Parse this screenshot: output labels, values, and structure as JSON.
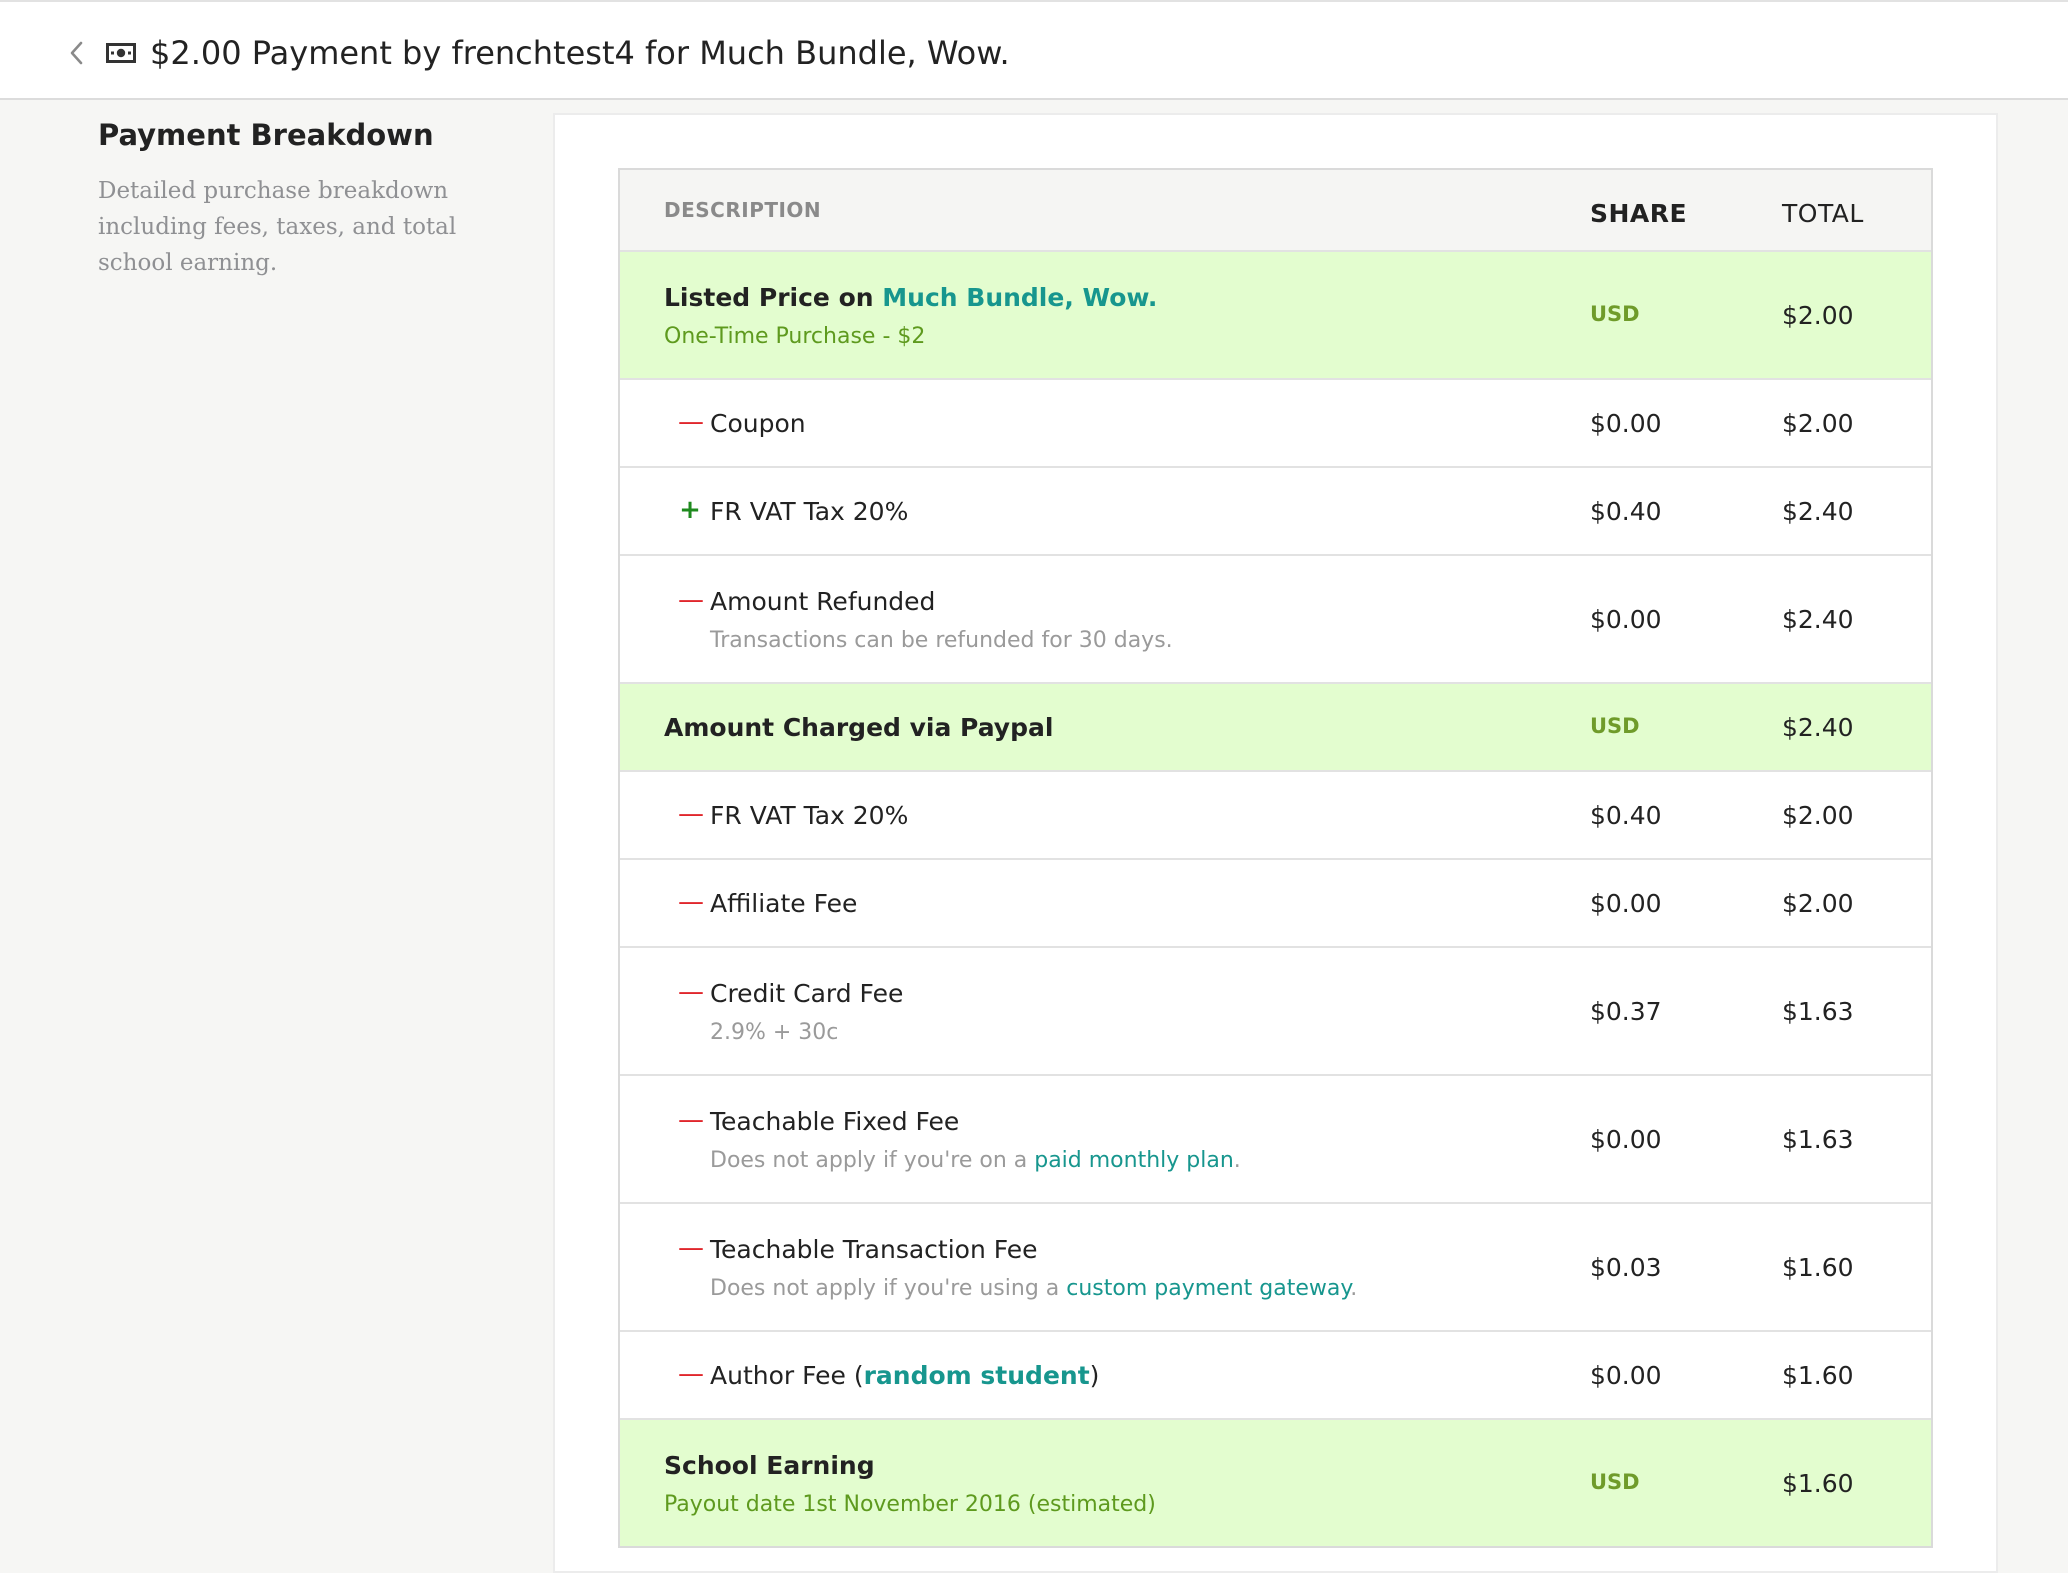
{
  "header": {
    "title": "$2.00 Payment by frenchtest4 for Much Bundle, Wow."
  },
  "sidebar": {
    "title": "Payment Breakdown",
    "description": "Detailed purchase breakdown including fees, taxes, and total school earning."
  },
  "table": {
    "columns": {
      "description": "DESCRIPTION",
      "share": "SHARE",
      "total": "TOTAL"
    },
    "listed": {
      "label_prefix": "Listed Price on ",
      "product": "Much Bundle, Wow.",
      "sub": "One-Time Purchase - $2",
      "share": "USD",
      "total": "$2.00"
    },
    "coupon": {
      "sign": "—",
      "label": "Coupon",
      "share": "$0.00",
      "total": "$2.00"
    },
    "vat_add": {
      "sign": "+",
      "label": "FR VAT Tax 20%",
      "share": "$0.40",
      "total": "$2.40"
    },
    "refund": {
      "sign": "—",
      "label": "Amount Refunded",
      "sub": "Transactions can be refunded for 30 days.",
      "share": "$0.00",
      "total": "$2.40"
    },
    "charged": {
      "label": "Amount Charged via Paypal",
      "share": "USD",
      "total": "$2.40"
    },
    "vat_sub": {
      "sign": "—",
      "label": "FR VAT Tax 20%",
      "share": "$0.40",
      "total": "$2.00"
    },
    "affiliate": {
      "sign": "—",
      "label": "Affiliate Fee",
      "share": "$0.00",
      "total": "$2.00"
    },
    "credit": {
      "sign": "—",
      "label": "Credit Card Fee",
      "sub": "2.9% + 30c",
      "share": "$0.37",
      "total": "$1.63"
    },
    "fixed": {
      "sign": "—",
      "label": "Teachable Fixed Fee",
      "sub_prefix": "Does not apply if you're on a ",
      "sub_link": "paid monthly plan",
      "sub_suffix": ".",
      "share": "$0.00",
      "total": "$1.63"
    },
    "transaction": {
      "sign": "—",
      "label": "Teachable Transaction Fee",
      "sub_prefix": "Does not apply if you're using a ",
      "sub_link": "custom payment gateway",
      "sub_suffix": ".",
      "share": "$0.03",
      "total": "$1.60"
    },
    "author": {
      "sign": "—",
      "label_prefix": "Author Fee (",
      "label_link": "random student",
      "label_suffix": ")",
      "share": "$0.00",
      "total": "$1.60"
    },
    "earning": {
      "label": "School Earning",
      "sub": "Payout date 1st November 2016 (estimated)",
      "share": "USD",
      "total": "$1.60"
    }
  }
}
